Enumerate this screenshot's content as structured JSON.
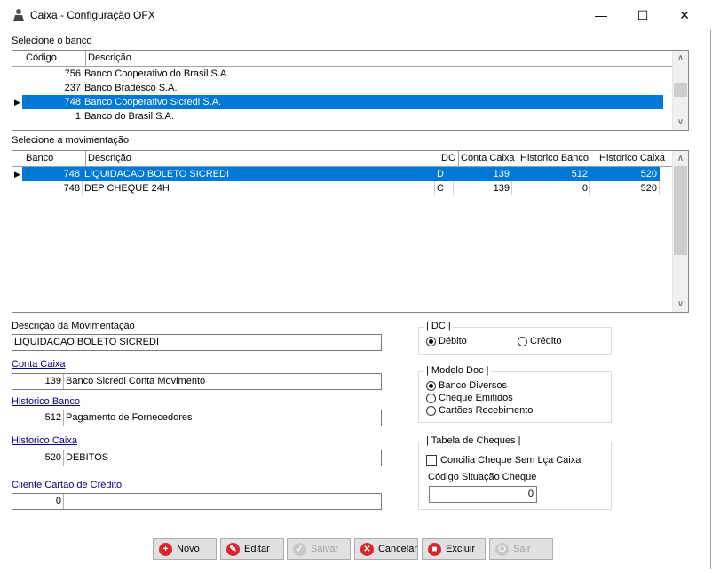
{
  "window": {
    "title": "Caixa - Configuração OFX",
    "minimize": "—",
    "maximize": "☐",
    "close": "✕"
  },
  "banks": {
    "label": "Selecione o banco",
    "columns": [
      "Código",
      "Descrição"
    ],
    "rows": [
      {
        "code": "756",
        "desc": "Banco Cooperativo do Brasil S.A."
      },
      {
        "code": "237",
        "desc": "Banco Bradesco S.A."
      },
      {
        "code": "748",
        "desc": "Banco Cooperativo Sicredi S.A."
      },
      {
        "code": "1",
        "desc": "Banco do Brasil S.A."
      }
    ],
    "selected_index": 2
  },
  "movements": {
    "label": "Selecione a movimentação",
    "columns": [
      "Banco",
      "Descrição",
      "DC",
      "Conta Caixa",
      "Historico Banco",
      "Historico Caixa"
    ],
    "rows": [
      {
        "banco": "748",
        "desc": "LIQUIDACAO BOLETO SICREDI",
        "dc": "D",
        "conta": "139",
        "hist_banco": "512",
        "hist_caixa": "520"
      },
      {
        "banco": "748",
        "desc": "DEP CHEQUE 24H",
        "dc": "C",
        "conta": "139",
        "hist_banco": "0",
        "hist_caixa": "520"
      }
    ],
    "selected_index": 0
  },
  "form": {
    "descricao_label": "Descrição da Movimentação",
    "descricao_value": "LIQUIDACAO BOLETO SICREDI",
    "conta_label": "Conta Caixa",
    "conta_code": "139",
    "conta_desc": "Banco Sicredi Conta Movimento",
    "hist_banco_label": "Historico Banco",
    "hist_banco_code": "512",
    "hist_banco_desc": "Pagamento de Fornecedores",
    "hist_caixa_label": "Historico Caixa",
    "hist_caixa_code": "520",
    "hist_caixa_desc": "DEBITOS",
    "cartao_label": "Cliente Cartão de Crédito",
    "cartao_code": "0",
    "cartao_desc": ""
  },
  "dc_group": {
    "title": "| DC |",
    "options": [
      "Débito",
      "Crédito"
    ],
    "selected": "Débito"
  },
  "modelo_group": {
    "title": "| Modelo Doc |",
    "options": [
      "Banco Diversos",
      "Cheque Emitidos",
      "Cartões Recebimento"
    ],
    "selected": "Banco Diversos"
  },
  "cheques_group": {
    "title": "| Tabela de Cheques |",
    "checkbox_label": "Concilia Cheque Sem Lça Caixa",
    "checked": false,
    "situacao_label": "Código Situação Cheque",
    "situacao_value": "0"
  },
  "buttons": {
    "novo": {
      "label": "Novo",
      "u": "N",
      "rest": "ovo",
      "color": "#d9262b",
      "icon": "+"
    },
    "editar": {
      "label": "Editar",
      "u": "E",
      "rest": "ditar",
      "color": "#d9262b",
      "icon": "✎"
    },
    "salvar": {
      "label": "Salvar",
      "u": "S",
      "rest": "alvar",
      "color": "#bdbdbd",
      "icon": "✓"
    },
    "cancelar": {
      "label": "Cancelar",
      "u": "C",
      "rest": "ancelar",
      "color": "#d9262b",
      "icon": "✕"
    },
    "excluir": {
      "label": "Excluir",
      "u": "x",
      "pre": "E",
      "rest": "cluir",
      "color": "#d9262b",
      "icon": "■"
    },
    "sair": {
      "label": "Sair",
      "u": "S",
      "rest": "air",
      "color": "#bdbdbd",
      "icon": "⏻"
    }
  }
}
